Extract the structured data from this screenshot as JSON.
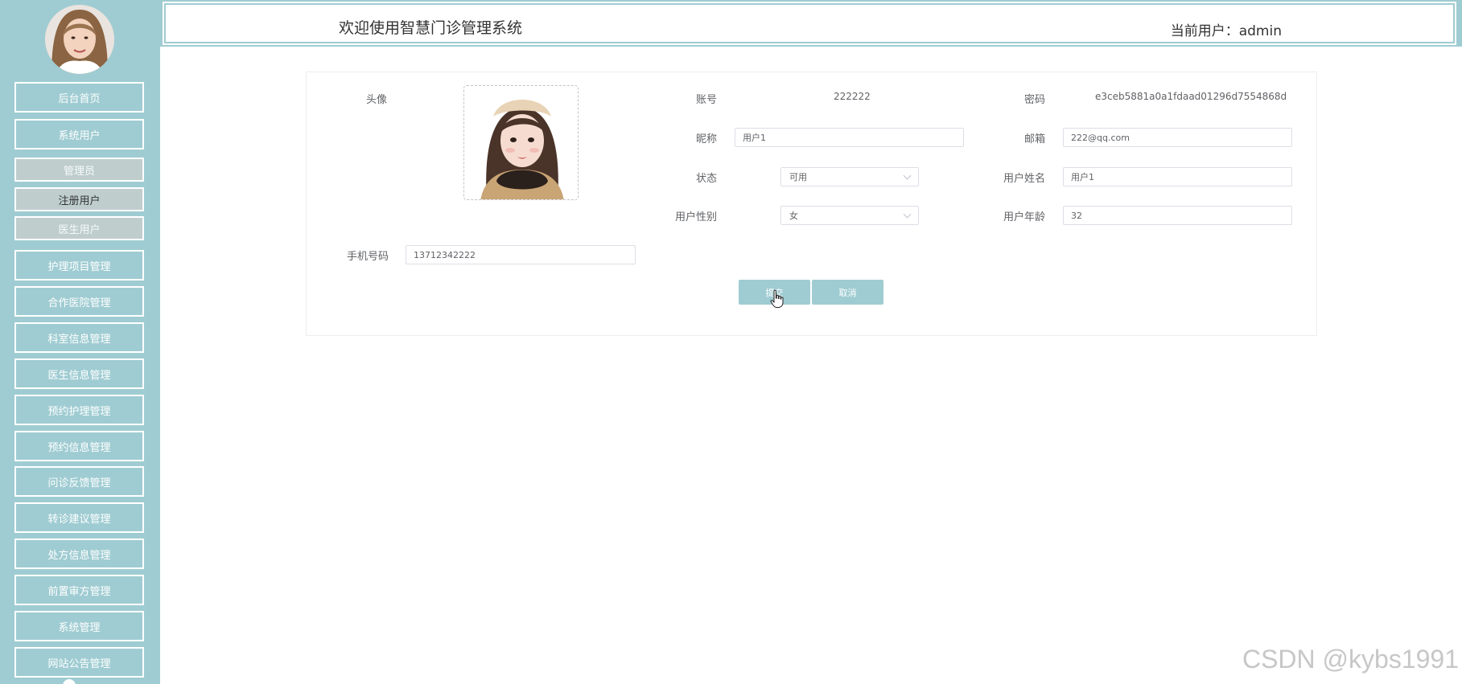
{
  "header": {
    "title": "欢迎使用智慧门诊管理系统",
    "current_user": "当前用户：admin"
  },
  "sidebar": {
    "avatar_icon": "user-avatar",
    "items": [
      {
        "label": "后台首页"
      },
      {
        "label": "系统用户"
      },
      {
        "label": "护理项目管理"
      },
      {
        "label": "合作医院管理"
      },
      {
        "label": "科室信息管理"
      },
      {
        "label": "医生信息管理"
      },
      {
        "label": "预约护理管理"
      },
      {
        "label": "预约信息管理"
      },
      {
        "label": "问诊反馈管理"
      },
      {
        "label": "转诊建议管理"
      },
      {
        "label": "处方信息管理"
      },
      {
        "label": "前置审方管理"
      },
      {
        "label": "系统管理"
      },
      {
        "label": "网站公告管理"
      }
    ],
    "sub_items": [
      {
        "label": "管理员"
      },
      {
        "label": "注册用户",
        "active": true
      },
      {
        "label": "医生用户"
      }
    ]
  },
  "form": {
    "avatar_label": "头像",
    "account_label": "账号",
    "account_value": "222222",
    "password_label": "密码",
    "password_value": "e3ceb5881a0a1fdaad01296d7554868d",
    "nickname_label": "昵称",
    "nickname_value": "用户1",
    "email_label": "邮箱",
    "email_value": "222@qq.com",
    "status_label": "状态",
    "status_value": "可用",
    "realname_label": "用户姓名",
    "realname_value": "用户1",
    "gender_label": "用户性别",
    "gender_value": "女",
    "age_label": "用户年龄",
    "age_value": "32",
    "phone_label": "手机号码",
    "phone_value": "13712342222",
    "submit_label": "提交",
    "cancel_label": "取消"
  },
  "colors": {
    "accent": "#9fccd2",
    "subitem_bg": "#bfcdcd"
  },
  "watermark": "CSDN @kybs1991"
}
